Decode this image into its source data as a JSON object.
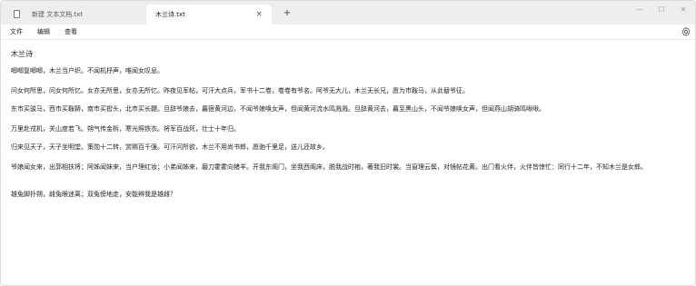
{
  "tabs": [
    {
      "label": "新建 文本文档.txt",
      "active": false
    },
    {
      "label": "木兰诗.txt",
      "active": true
    }
  ],
  "tab_close_glyph": "×",
  "new_tab_glyph": "+",
  "window_controls": {
    "minimize": "—",
    "maximize": "☐",
    "close": "✕"
  },
  "menu": {
    "file": "文件",
    "edit": "编辑",
    "view": "查看"
  },
  "icons": {
    "settings": "gear-icon",
    "document": "document-icon"
  },
  "document": {
    "lines": [
      "木兰诗",
      "唧唧复唧唧，木兰当户织。不闻机杼声，唯闻女叹息。",
      "问女何所思，问女何所忆。女亦无所思，女亦无所忆。昨夜见军帖，可汗大点兵，军书十二卷，卷卷有爷名。阿爷无大儿，木兰无长兄，愿为市鞍马，从此替爷征。",
      "东市买骏马，西市买鞍鞯，南市买辔头，北市买长鞭。旦辞爷娘去，暮宿黄河边，不闻爷娘唤女声，但闻黄河流水鸣溅溅。旦辞黄河去，暮至黑山头，不闻爷娘唤女声，但闻燕山胡骑鸣啾啾。",
      "万里赴戎机，关山度若飞。朔气传金柝，寒光照铁衣。将军百战死，壮士十年归。",
      "归来见天子，天子坐明堂。策勋十二转，赏赐百千强。可汗问所欲，木兰不用尚书郎，愿驰千里足，送儿还故乡。",
      "爷娘闻女来，出郭相扶将；阿姊闻妹来，当户理红妆；小弟闻姊来，磨刀霍霍向猪羊。开我东阁门，坐我西阁床，脱我战时袍，著我旧时裳。当窗理云鬓，对镜帖花黄。出门看火伴，火伴皆惊忙：同行十二年，不知木兰是女郎。",
      "雄兔脚扑朔，雌兔眼迷离；双兔傍地走，安能辨我是雄雌？"
    ]
  }
}
